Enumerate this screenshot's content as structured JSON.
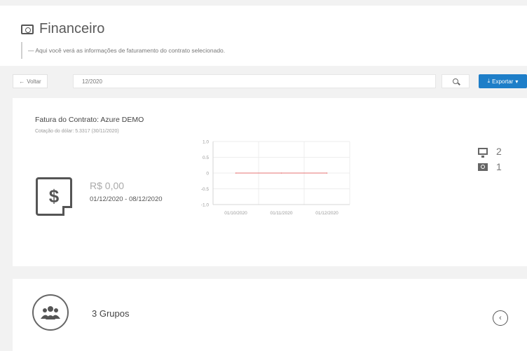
{
  "header": {
    "title": "Financeiro",
    "subtitle": "— Aqui você verá as informações de faturamento do contrato selecionado."
  },
  "filter": {
    "back_label": "Voltar",
    "period_value": "12/2020",
    "export_label": "Exportar"
  },
  "contract": {
    "title": "Fatura do Contrato: Azure DEMO",
    "exchange_note": "Cotação do dólar: 5.3317 (30/11/2020)",
    "amount": "R$ 0,00",
    "period_range": "01/12/2020 - 08/12/2020"
  },
  "stats": {
    "machines_count": "2",
    "billing_count": "1"
  },
  "groups": {
    "label": "3 Grupos"
  },
  "colors": {
    "accent": "#1e7ec8",
    "series": "#e57373",
    "grid": "#e8e8e8"
  },
  "chart_data": {
    "type": "line",
    "categories": [
      "01/10/2020",
      "01/11/2020",
      "01/12/2020"
    ],
    "series": [
      {
        "values": [
          0,
          0,
          0
        ]
      }
    ],
    "y_ticks": [
      "1.0",
      "0.5",
      "0",
      "-0.5",
      "-1.0"
    ],
    "ylim": [
      -1.0,
      1.0
    ],
    "grid": true
  }
}
